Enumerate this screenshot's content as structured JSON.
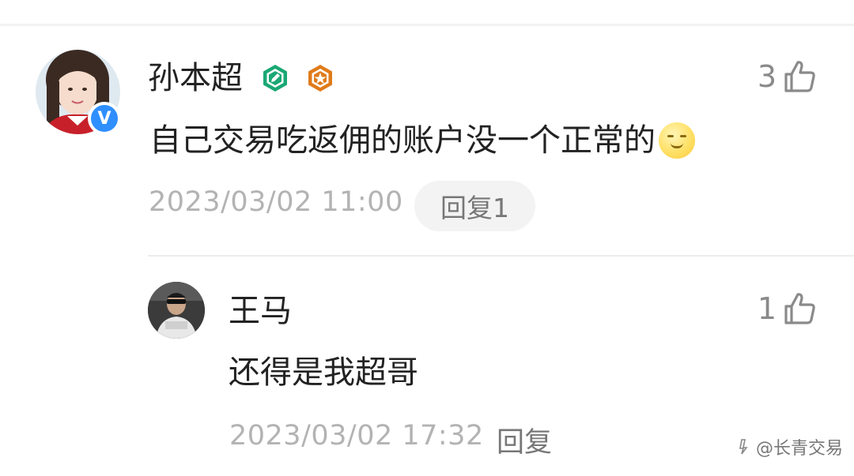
{
  "main_comment": {
    "username": "孙本超",
    "text": "自己交易吃返佣的账户没一个正常的",
    "emoji": "smirk-face-emoji",
    "timestamp": "2023/03/02 11:00",
    "reply_label": "回复1",
    "likes": "3",
    "verified_mark": "V",
    "badges": [
      "pencil-badge-icon",
      "star-badge-icon"
    ]
  },
  "reply_comment": {
    "username": "王马",
    "text": "还得是我超哥",
    "timestamp": "2023/03/02 17:32",
    "reply_label": "回复",
    "likes": "1"
  },
  "watermark": {
    "text": "@长青交易"
  },
  "colors": {
    "verified_blue": "#2f8fff",
    "badge_green": "#1aa874",
    "badge_orange": "#e07b1a",
    "muted_text": "#b3b3b3",
    "icon_gray": "#8a8a8a"
  }
}
